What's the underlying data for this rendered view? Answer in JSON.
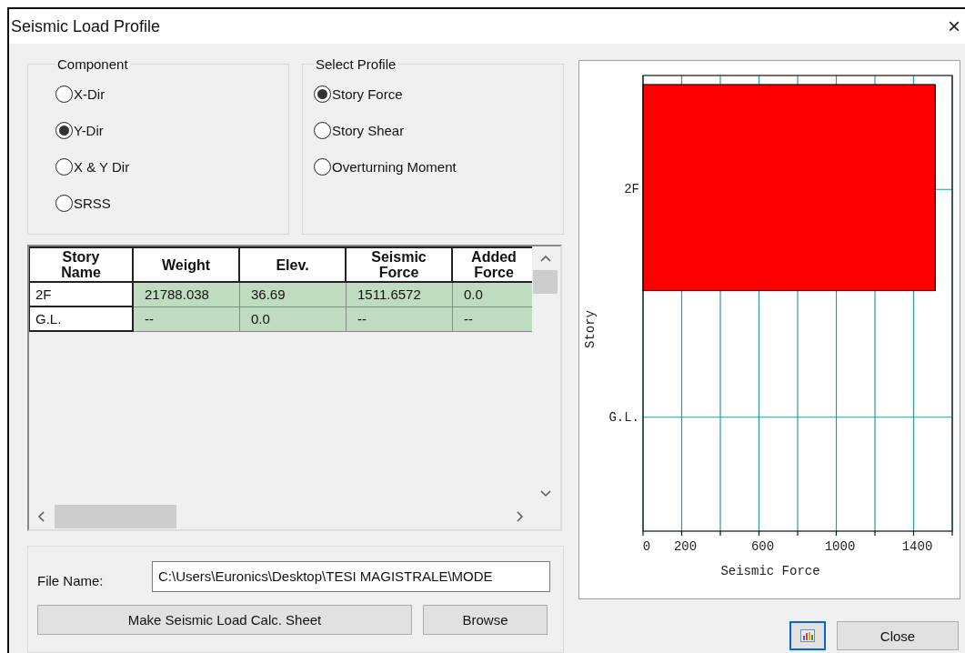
{
  "window": {
    "title": "Seismic Load Profile",
    "close": "×"
  },
  "component": {
    "label": "Component",
    "options": [
      {
        "label": "X-Dir",
        "selected": false
      },
      {
        "label": "Y-Dir",
        "selected": true
      },
      {
        "label": "X & Y Dir",
        "selected": false
      },
      {
        "label": "SRSS",
        "selected": false
      }
    ]
  },
  "profile": {
    "label": "Select Profile",
    "options": [
      {
        "label": "Story Force",
        "selected": true
      },
      {
        "label": "Story Shear",
        "selected": false
      },
      {
        "label": "Overturning Moment",
        "selected": false
      }
    ]
  },
  "table": {
    "columns": [
      "Story Name",
      "Weight",
      "Elev.",
      "Seismic Force",
      "Added Force"
    ],
    "rows": [
      {
        "cells": [
          "2F",
          "21788.038",
          "36.69",
          "1511.6572",
          "0.0"
        ]
      },
      {
        "cells": [
          "G.L.",
          "--",
          "0.0",
          "--",
          "--"
        ]
      }
    ]
  },
  "file": {
    "label": "File Name:",
    "value": "C:\\Users\\Euronics\\Desktop\\TESI MAGISTRALE\\MODE"
  },
  "buttons": {
    "make_sheet": "Make Seismic Load Calc. Sheet",
    "browse": "Browse",
    "close": "Close"
  },
  "chart": {
    "chart_data": {
      "type": "bar",
      "orientation": "horizontal",
      "xlabel": "Seismic Force",
      "ylabel": "Story",
      "categories": [
        "2F",
        "G.L."
      ],
      "values": [
        1512,
        null
      ],
      "xlim": [
        0,
        1600
      ],
      "xticks": [
        0,
        200,
        600,
        1000,
        1400
      ],
      "grid": true
    }
  }
}
